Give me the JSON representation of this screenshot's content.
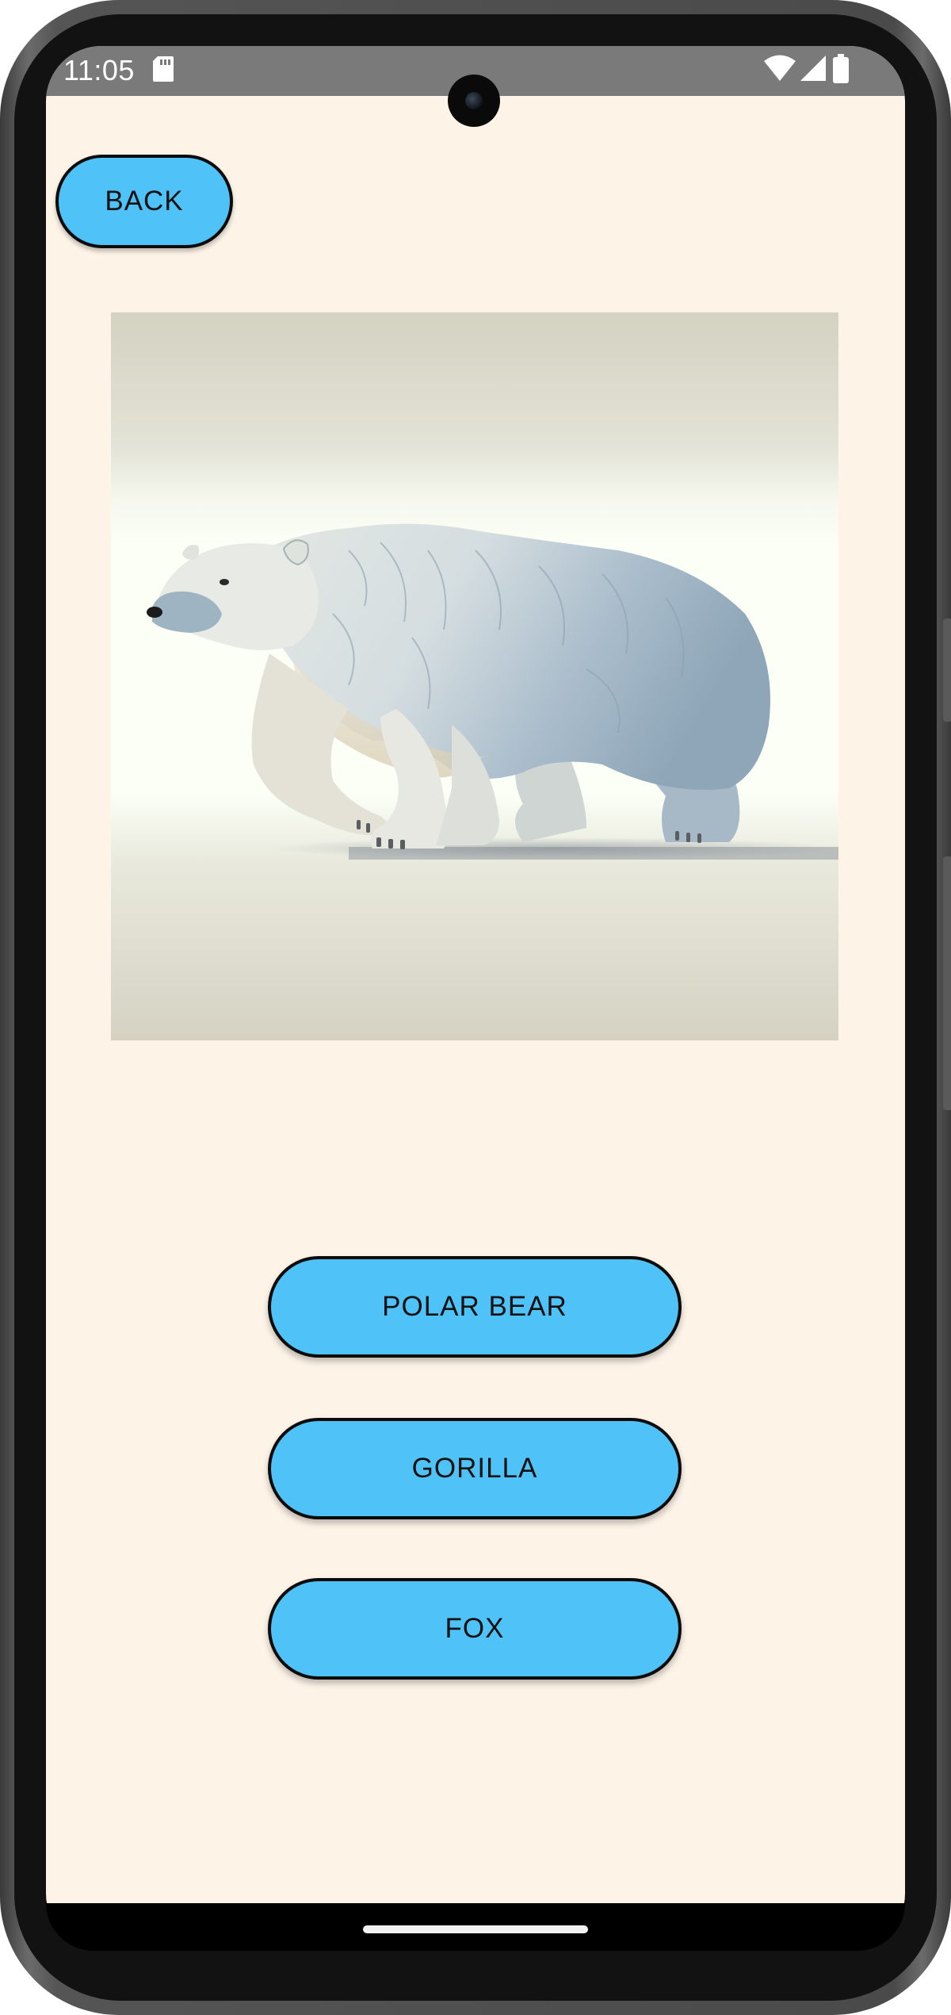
{
  "status_bar": {
    "time": "11:05",
    "icons": [
      "sd-card-icon",
      "wifi-icon",
      "cellular-signal-icon",
      "battery-icon"
    ]
  },
  "toolbar": {
    "back_label": "BACK"
  },
  "question": {
    "image_subject": "polar bear"
  },
  "answers": [
    {
      "label": "POLAR BEAR"
    },
    {
      "label": "GORILLA"
    },
    {
      "label": "FOX"
    }
  ],
  "colors": {
    "background": "#fdf3e7",
    "button_fill": "#4fc3f7",
    "button_border": "#0b0b0b",
    "status_bar": "#7a7a7a"
  }
}
